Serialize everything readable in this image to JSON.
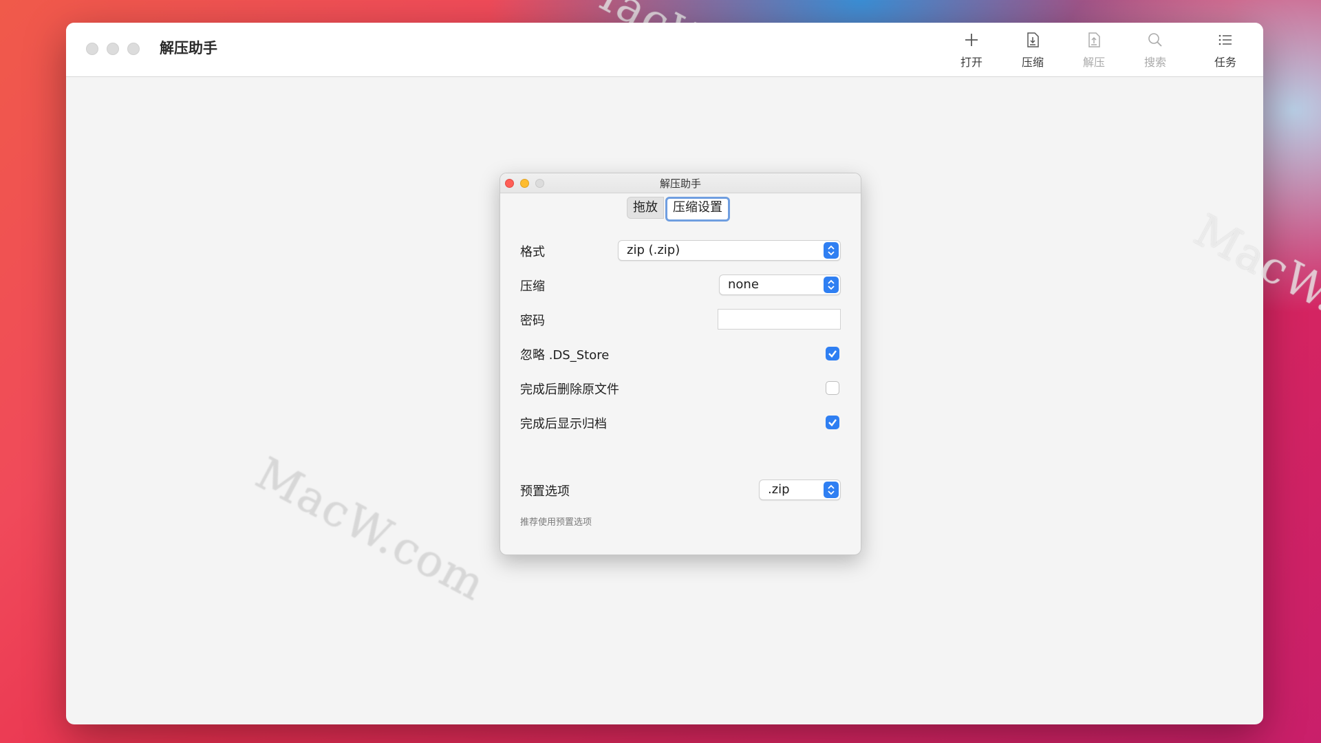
{
  "app": {
    "title": "解压助手"
  },
  "toolbar": {
    "items": [
      {
        "label": "打开",
        "icon": "plus-icon",
        "enabled": true
      },
      {
        "label": "压缩",
        "icon": "compress-doc-icon",
        "enabled": true
      },
      {
        "label": "解压",
        "icon": "extract-doc-icon",
        "enabled": false
      },
      {
        "label": "搜索",
        "icon": "search-icon",
        "enabled": false
      },
      {
        "label": "任务",
        "icon": "list-icon",
        "enabled": true
      }
    ]
  },
  "dialog": {
    "title": "解压助手",
    "tabs": [
      {
        "label": "拖放",
        "active": false
      },
      {
        "label": "压缩设置",
        "active": true
      }
    ],
    "settings": {
      "format": {
        "label": "格式",
        "value": "zip (.zip)"
      },
      "compression": {
        "label": "压缩",
        "value": "none"
      },
      "password": {
        "label": "密码",
        "value": ""
      },
      "ignore_ds_store": {
        "label": "忽略 .DS_Store",
        "checked": true
      },
      "delete_after": {
        "label": "完成后删除原文件",
        "checked": false
      },
      "show_archive": {
        "label": "完成后显示归档",
        "checked": true
      },
      "preset": {
        "label": "预置选项",
        "value": ".zip"
      },
      "hint": "推荐使用预置选项"
    }
  },
  "watermark": {
    "text": "MacW.com"
  },
  "colors": {
    "accent": "#2f7ff2",
    "close": "#ff5f57",
    "minimize": "#febc2e",
    "inactive": "#d8d8d8"
  }
}
